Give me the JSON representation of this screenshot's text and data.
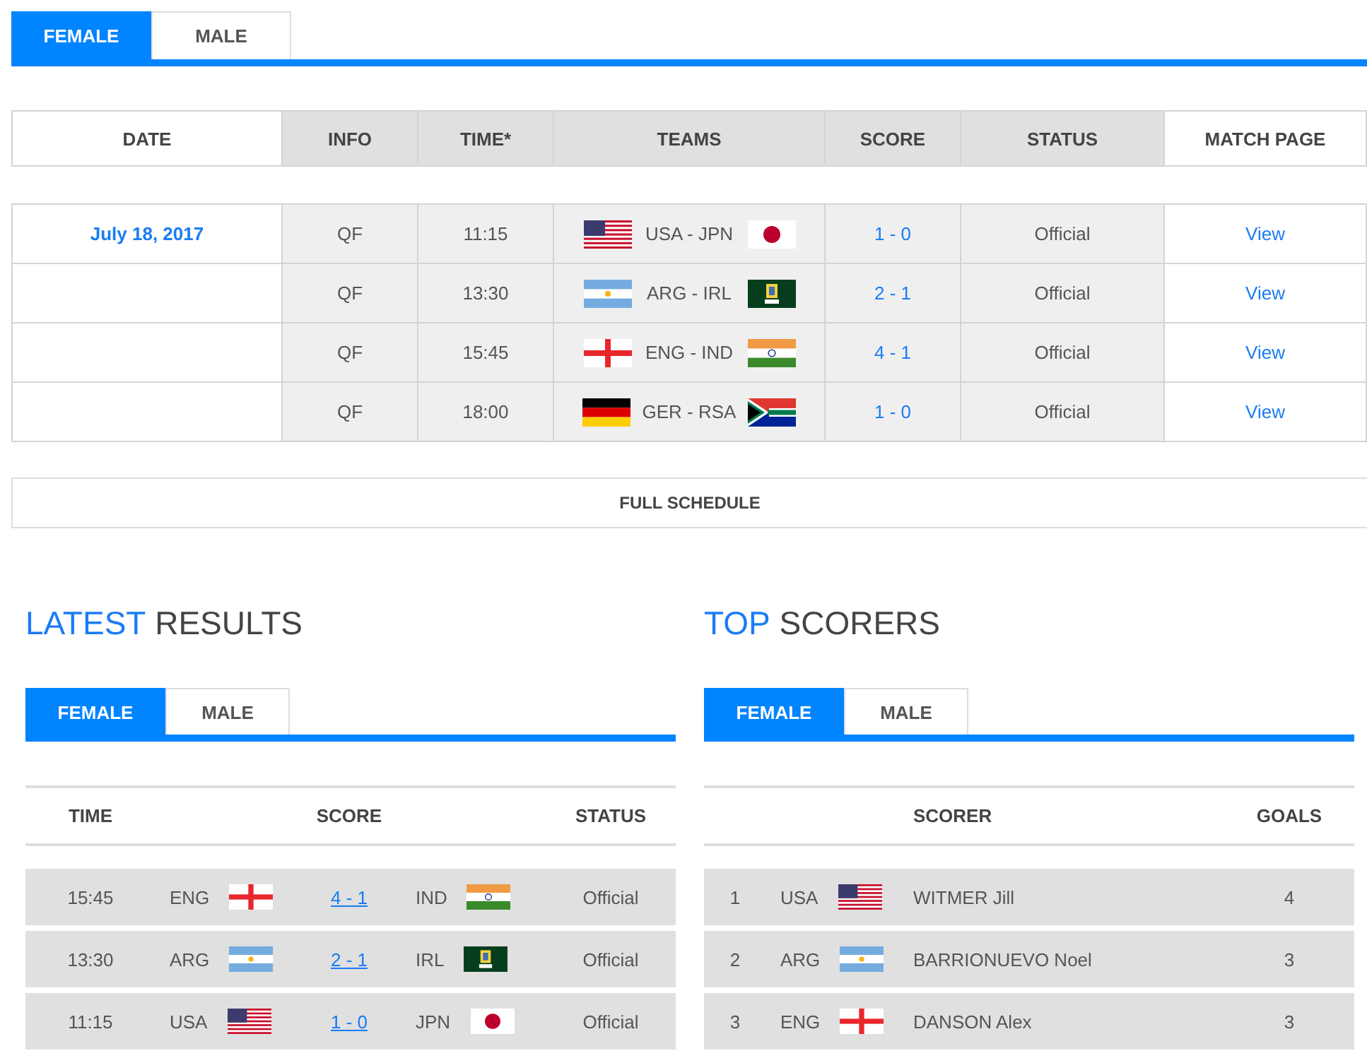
{
  "schedule_tabs": [
    {
      "label": "FEMALE",
      "selected": true
    },
    {
      "label": "MALE",
      "selected": false
    }
  ],
  "schedule": {
    "columns": [
      "DATE",
      "INFO",
      "TIME*",
      "TEAMS",
      "SCORE",
      "STATUS",
      "MATCH PAGE"
    ],
    "rows": [
      {
        "date": "July 18, 2017",
        "info": "QF",
        "time": "11:15",
        "teams": "USA - JPN",
        "flag_home": {
          "kind": "us"
        },
        "flag_away": {
          "kind": "jp"
        },
        "score": "1 - 0",
        "status": "Official",
        "link": "View"
      },
      {
        "info": "QF",
        "time": "13:30",
        "teams": "ARG - IRL",
        "flag_home": {
          "kind": "ar"
        },
        "flag_away": {
          "kind": "crest"
        },
        "score": "2 - 1",
        "status": "Official",
        "link": "View"
      },
      {
        "info": "QF",
        "time": "15:45",
        "teams": "ENG - IND",
        "flag_home": {
          "kind": "cross"
        },
        "flag_away": {
          "kind": "in"
        },
        "score": "4 - 1",
        "status": "Official",
        "link": "View"
      },
      {
        "info": "QF",
        "time": "18:00",
        "teams": "GER - RSA",
        "flag_home": {
          "kind": "de"
        },
        "flag_away": {
          "kind": "za"
        },
        "score": "1 - 0",
        "status": "Official",
        "link": "View"
      }
    ],
    "full_schedule": "FULL SCHEDULE"
  },
  "latest_results": {
    "title": {
      "accent": "LATEST",
      "rest": "RESULTS"
    },
    "tabs": [
      {
        "label": "FEMALE",
        "selected": true
      },
      {
        "label": "MALE",
        "selected": false
      }
    ],
    "columns": [
      "TIME",
      "SCORE",
      "STATUS"
    ],
    "rows": [
      {
        "time": "15:45",
        "home": "ENG",
        "flag_home": {
          "kind": "cross"
        },
        "score": "4 - 1",
        "away": "IND",
        "flag_away": {
          "kind": "in"
        },
        "status": "Official"
      },
      {
        "time": "13:30",
        "home": "ARG",
        "flag_home": {
          "kind": "ar"
        },
        "score": "2 - 1",
        "away": "IRL",
        "flag_away": {
          "kind": "crest"
        },
        "status": "Official"
      },
      {
        "time": "11:15",
        "home": "USA",
        "flag_home": {
          "kind": "us"
        },
        "score": "1 - 0",
        "away": "JPN",
        "flag_away": {
          "kind": "jp"
        },
        "status": "Official"
      }
    ]
  },
  "top_scorers": {
    "title": {
      "accent": "TOP",
      "rest": "SCORERS"
    },
    "tabs": [
      {
        "label": "FEMALE",
        "selected": true
      },
      {
        "label": "MALE",
        "selected": false
      }
    ],
    "columns": [
      "SCORER",
      "GOALS"
    ],
    "rows": [
      {
        "rank": "1",
        "country": "USA",
        "flag": {
          "kind": "us"
        },
        "name": "WITMER Jill",
        "goals": "4"
      },
      {
        "rank": "2",
        "country": "ARG",
        "flag": {
          "kind": "ar"
        },
        "name": "BARRIONUEVO Noel",
        "goals": "3"
      },
      {
        "rank": "3",
        "country": "ENG",
        "flag": {
          "kind": "cross"
        },
        "name": "DANSON Alex",
        "goals": "3"
      }
    ]
  }
}
